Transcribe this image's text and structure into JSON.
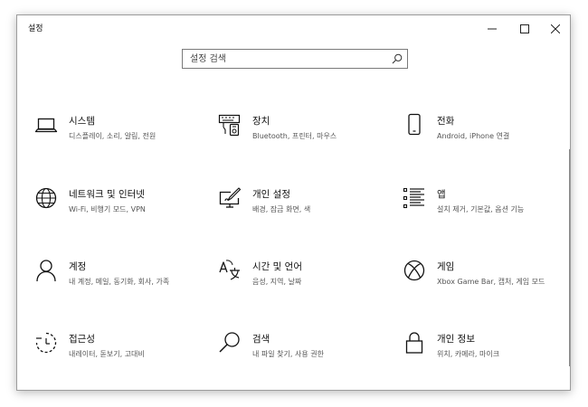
{
  "window": {
    "title": "설정"
  },
  "controls": {
    "minimize": "minimize-icon",
    "maximize": "maximize-icon",
    "close": "close-icon"
  },
  "search": {
    "value": "",
    "placeholder": "설정 검색",
    "icon": "search-icon"
  },
  "tiles": [
    {
      "title": "시스템",
      "desc": "디스플레이, 소리, 알림, 전원",
      "icon": "laptop-icon"
    },
    {
      "title": "장치",
      "desc": "Bluetooth, 프린터, 마우스",
      "icon": "devices-icon"
    },
    {
      "title": "전화",
      "desc": "Android, iPhone 연결",
      "icon": "phone-icon"
    },
    {
      "title": "네트워크 및 인터넷",
      "desc": "Wi-Fi, 비행기 모드, VPN",
      "icon": "globe-icon"
    },
    {
      "title": "개인 설정",
      "desc": "배경, 잠금 화면, 색",
      "icon": "personalization-icon"
    },
    {
      "title": "앱",
      "desc": "설치 제거, 기본값, 옵션 기능",
      "icon": "apps-list-icon"
    },
    {
      "title": "계정",
      "desc": "내 계정, 메일, 동기화, 회사, 가족",
      "icon": "person-icon"
    },
    {
      "title": "시간 및 언어",
      "desc": "음성, 지역, 날짜",
      "icon": "time-language-icon"
    },
    {
      "title": "게임",
      "desc": "Xbox Game Bar, 캡처, 게임 모드",
      "icon": "xbox-icon"
    },
    {
      "title": "접근성",
      "desc": "내레이터, 돋보기, 고대비",
      "icon": "accessibility-icon"
    },
    {
      "title": "검색",
      "desc": "내 파일 찾기, 사용 권한",
      "icon": "search-icon"
    },
    {
      "title": "개인 정보",
      "desc": "위치, 카메라, 마이크",
      "icon": "lock-icon"
    }
  ]
}
